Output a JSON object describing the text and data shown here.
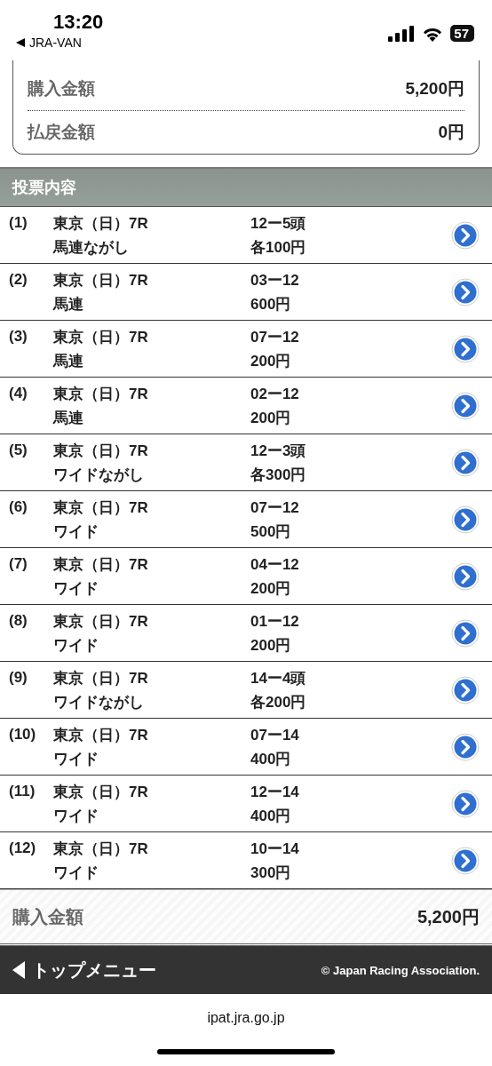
{
  "status_bar": {
    "time": "13:20",
    "back_app": "JRA-VAN",
    "battery": "57"
  },
  "summary": [
    {
      "label": "購入金額",
      "value": "5,200円"
    },
    {
      "label": "払戻金額",
      "value": "0円"
    }
  ],
  "section_title": "投票内容",
  "bets": [
    {
      "number": "(1)",
      "race": "東京（日）7R",
      "type": "馬連ながし",
      "combination": "12ー5頭",
      "amount": "各100円"
    },
    {
      "number": "(2)",
      "race": "東京（日）7R",
      "type": "馬連",
      "combination": "03ー12",
      "amount": "600円"
    },
    {
      "number": "(3)",
      "race": "東京（日）7R",
      "type": "馬連",
      "combination": "07ー12",
      "amount": "200円"
    },
    {
      "number": "(4)",
      "race": "東京（日）7R",
      "type": "馬連",
      "combination": "02ー12",
      "amount": "200円"
    },
    {
      "number": "(5)",
      "race": "東京（日）7R",
      "type": "ワイドながし",
      "combination": "12ー3頭",
      "amount": "各300円"
    },
    {
      "number": "(6)",
      "race": "東京（日）7R",
      "type": "ワイド",
      "combination": "07ー12",
      "amount": "500円"
    },
    {
      "number": "(7)",
      "race": "東京（日）7R",
      "type": "ワイド",
      "combination": "04ー12",
      "amount": "200円"
    },
    {
      "number": "(8)",
      "race": "東京（日）7R",
      "type": "ワイド",
      "combination": "01ー12",
      "amount": "200円"
    },
    {
      "number": "(9)",
      "race": "東京（日）7R",
      "type": "ワイドながし",
      "combination": "14ー4頭",
      "amount": "各200円"
    },
    {
      "number": "(10)",
      "race": "東京（日）7R",
      "type": "ワイド",
      "combination": "07ー14",
      "amount": "400円"
    },
    {
      "number": "(11)",
      "race": "東京（日）7R",
      "type": "ワイド",
      "combination": "12ー14",
      "amount": "400円"
    },
    {
      "number": "(12)",
      "race": "東京（日）7R",
      "type": "ワイド",
      "combination": "10ー14",
      "amount": "300円"
    }
  ],
  "total": {
    "label": "購入金額",
    "value": "5,200円"
  },
  "footer": {
    "menu_link": "トップメニュー",
    "copyright": "© Japan Racing Association."
  },
  "url": "ipat.jra.go.jp"
}
